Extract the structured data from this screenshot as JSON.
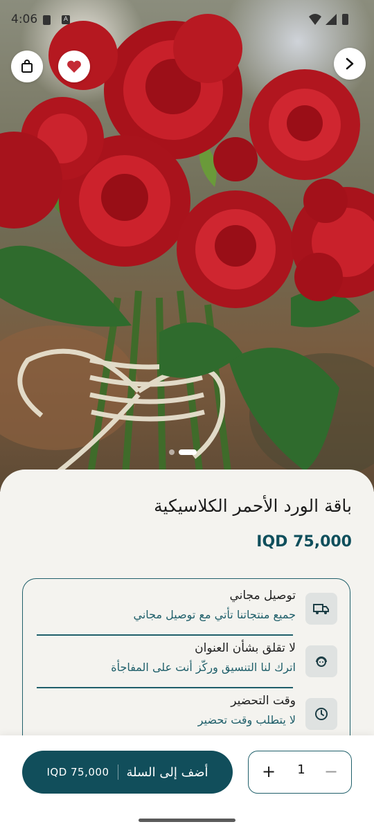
{
  "status_bar": {
    "time": "4:06"
  },
  "product": {
    "title": "باقة الورد الأحمر الكلاسيكية",
    "price": "IQD 75,000"
  },
  "features": [
    {
      "icon": "truck-icon",
      "title": "توصيل مجاني",
      "desc": "جميع منتجاتنا تأتي مع توصيل مجاني"
    },
    {
      "icon": "support-agent-icon",
      "title": "لا تقلق بشأن العنوان",
      "desc": "اترك لنا التنسيق وركّز أنت على المفاجأة"
    },
    {
      "icon": "clock-icon",
      "title": "وقت التحضير",
      "desc": "لا يتطلب وقت تحضير"
    }
  ],
  "cart": {
    "add_label": "أضف إلى السلة",
    "amount": "IQD 75,000",
    "quantity": "1",
    "plus": "+",
    "minus": "−"
  },
  "gallery": {
    "image_count": 2,
    "active_index": 1
  },
  "colors": {
    "accent": "#114e5b",
    "rose": "#c21a24"
  }
}
